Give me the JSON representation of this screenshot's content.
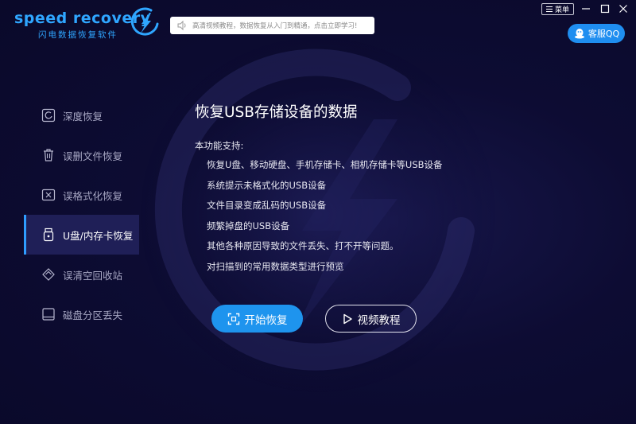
{
  "brand": {
    "name": "speed recovery",
    "subtitle": "闪电数据恢复软件",
    "accent": "#2fa6ff"
  },
  "notice": {
    "text": "高清视频教程，数据恢复从入门到精通，点击立即学习!"
  },
  "titlebar": {
    "menu_label": "菜单",
    "minimize_icon": "minus",
    "maximize_icon": "square",
    "close_icon": "x"
  },
  "support": {
    "label": "客服QQ",
    "color": "#1f8ef0"
  },
  "sidebar": {
    "items": [
      {
        "label": "深度恢复",
        "icon": "deep-recovery-icon"
      },
      {
        "label": "误删文件恢复",
        "icon": "trash-icon"
      },
      {
        "label": "误格式化恢复",
        "icon": "format-icon"
      },
      {
        "label": "U盘/内存卡恢复",
        "icon": "usb-icon",
        "active": true
      },
      {
        "label": "误清空回收站",
        "icon": "recycle-icon"
      },
      {
        "label": "磁盘分区丢失",
        "icon": "disk-icon"
      }
    ]
  },
  "main": {
    "title": "恢复USB存储设备的数据",
    "intro": "本功能支持:",
    "features": [
      "恢复U盘、移动硬盘、手机存储卡、相机存储卡等USB设备",
      "系统提示未格式化的USB设备",
      "文件目录变成乱码的USB设备",
      "频繁掉盘的USB设备",
      "其他各种原因导致的文件丢失、打不开等问题。",
      "对扫描到的常用数据类型进行预览"
    ],
    "start_button": "开始恢复",
    "video_button": "视频教程"
  }
}
